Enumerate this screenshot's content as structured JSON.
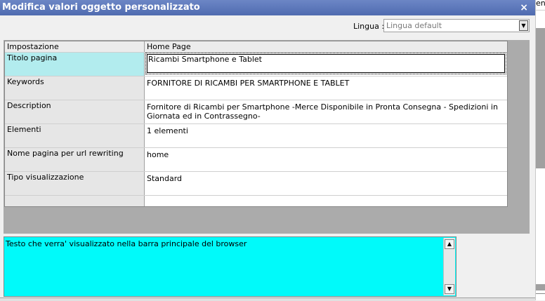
{
  "window": {
    "title": "Modifica valori oggetto personalizzato",
    "close_symbol": "×"
  },
  "right_strip_text": "ent",
  "language": {
    "label": "Lingua :",
    "selected": "Lingua default",
    "dropdown_symbol": "▼"
  },
  "grid": {
    "headers": [
      "Impostazione",
      "Home Page"
    ],
    "rows": [
      {
        "name": "Titolo pagina",
        "value": "Ricambi Smartphone e Tablet"
      },
      {
        "name": "Keywords",
        "value": "FORNITORE DI RICAMBI PER SMARTPHONE E TABLET"
      },
      {
        "name": "Description",
        "value": "Fornitore di Ricambi per Smartphone -Merce Disponibile in Pronta Consegna - Spedizioni in Giornata ed in Contrassegno-"
      },
      {
        "name": "Elementi",
        "value": "1 elementi"
      },
      {
        "name": "Nome pagina per url rewriting",
        "value": "home"
      },
      {
        "name": "Tipo visualizzazione",
        "value": "Standard"
      }
    ]
  },
  "help": {
    "text": "Testo che verra' visualizzato nella barra principale del browser",
    "up_symbol": "▲",
    "down_symbol": "▼"
  }
}
